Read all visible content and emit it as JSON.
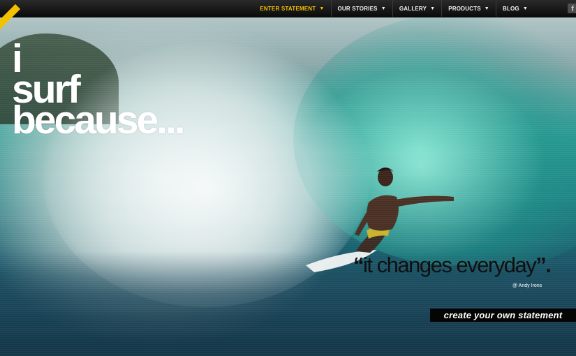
{
  "nav": {
    "items": [
      {
        "label": "ENTER STATEMENT",
        "active": true
      },
      {
        "label": "OUR STORIES",
        "active": false
      },
      {
        "label": "GALLERY",
        "active": false
      },
      {
        "label": "PRODUCTS",
        "active": false
      },
      {
        "label": "BLOG",
        "active": false
      }
    ],
    "dropdown_icon": "chevron-down-icon",
    "social_icon": "facebook-icon",
    "social_glyph": "f",
    "active_color": "#f2c200"
  },
  "hero": {
    "headline_lines": [
      "i",
      "surf",
      "because..."
    ],
    "quote_open": "“",
    "quote_text": "it changes everyday",
    "quote_close": "”.",
    "quote_author": "@ Andy Irons",
    "cta_label": "create your own statement"
  },
  "colors": {
    "nav_bg": "#111111",
    "cta_bg": "#050505",
    "headline": "#ffffff",
    "quote": "#101010"
  }
}
